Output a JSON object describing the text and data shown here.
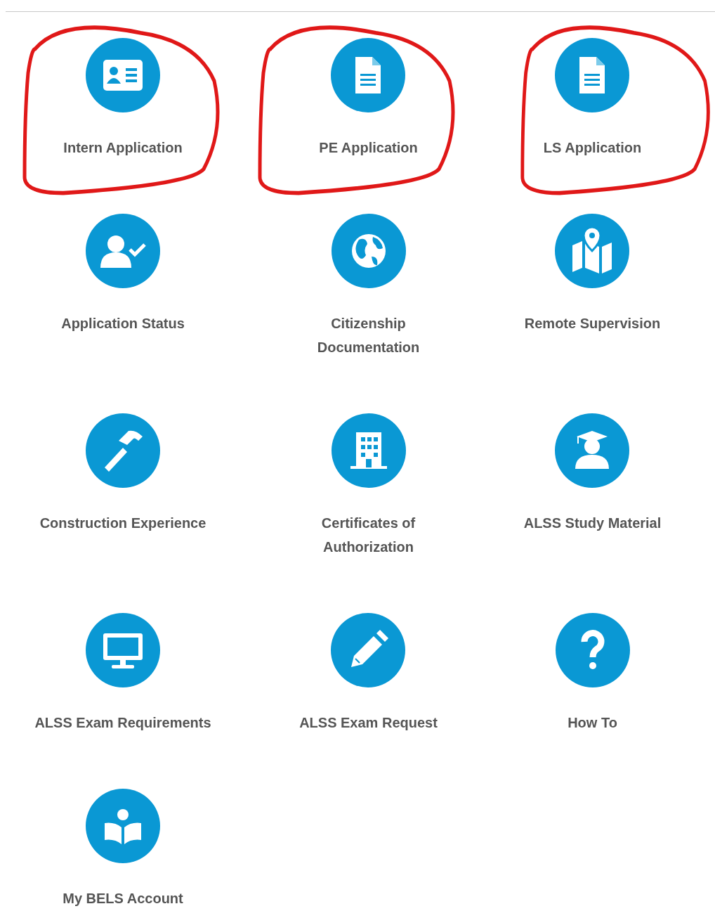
{
  "tiles": [
    {
      "label": "Intern Application",
      "circled": true
    },
    {
      "label": "PE Application",
      "circled": true
    },
    {
      "label": "LS Application",
      "circled": true
    },
    {
      "label": "Application Status",
      "circled": false
    },
    {
      "label": "Citizenship Documentation",
      "circled": false
    },
    {
      "label": "Remote Supervision",
      "circled": false
    },
    {
      "label": "Construction Experience",
      "circled": false
    },
    {
      "label": "Certificates of Authorization",
      "circled": false
    },
    {
      "label": "ALSS Study Material",
      "circled": false
    },
    {
      "label": "ALSS Exam Requirements",
      "circled": false
    },
    {
      "label": "ALSS Exam Request",
      "circled": false
    },
    {
      "label": "How To",
      "circled": false
    },
    {
      "label": "My BELS Account",
      "circled": false
    }
  ]
}
